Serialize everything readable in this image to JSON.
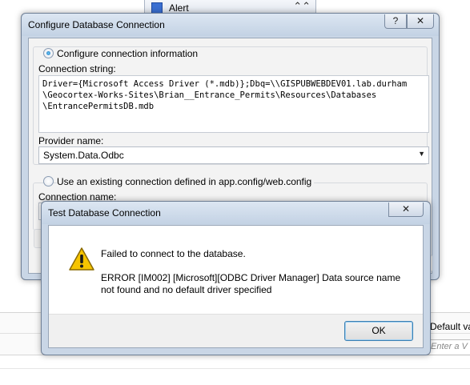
{
  "background": {
    "alert_panel": {
      "title": "Alert",
      "collapse_glyph": "⌃⌃"
    },
    "default_value_label": "Default va",
    "default_value_placeholder": "Enter a V"
  },
  "configure_window": {
    "title": "Configure Database Connection",
    "help_glyph": "?",
    "close_glyph": "✕",
    "option_configure_label": "Configure connection information",
    "connection_string_label": "Connection string:",
    "connection_string_value": "Driver={Microsoft Access Driver (*.mdb)};Dbq=\\\\GISPUBWEBDEV01.lab.durham\n\\Geocortex-Works-Sites\\Brian__Entrance_Permits\\Resources\\Databases\n\\EntrancePermitsDB.mdb",
    "provider_name_label": "Provider name:",
    "provider_name_value": "System.Data.Odbc",
    "option_existing_label": "Use an existing connection defined in app.config/web.config",
    "connection_name_label": "Connection name:"
  },
  "test_dialog": {
    "title": "Test Database Connection",
    "close_glyph": "✕",
    "icon": "warning-icon",
    "message_line1": "Failed to connect to the database.",
    "message_line2": "ERROR [IM002] [Microsoft][ODBC Driver Manager] Data source name",
    "message_line3": "not found and no default driver specified",
    "ok_label": "OK"
  },
  "colors": {
    "warning_yellow": "#f6c400",
    "titlebar": "#c9d6e6",
    "ok_focus": "#3c7fb1"
  }
}
